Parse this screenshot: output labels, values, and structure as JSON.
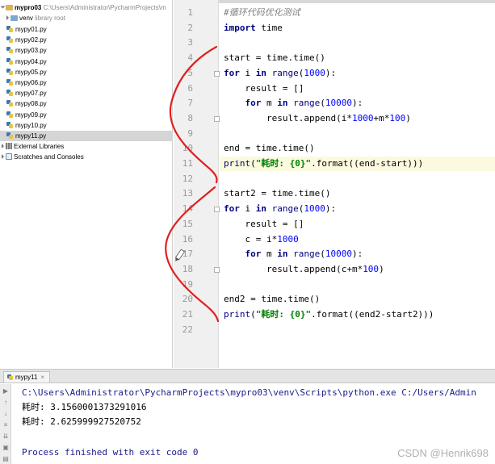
{
  "project_tree": {
    "root": {
      "name": "mypro03",
      "path": "C:\\Users\\Administrator\\PycharmProjects\\m"
    },
    "venv": {
      "name": "venv",
      "note": "library root"
    },
    "files": [
      "mypy01.py",
      "mypy02.py",
      "mypy03.py",
      "mypy04.py",
      "mypy05.py",
      "mypy06.py",
      "mypy07.py",
      "mypy08.py",
      "mypy09.py",
      "mypy10.py",
      "mypy11.py"
    ],
    "selected_file": "mypy11.py",
    "external": "External Libraries",
    "scratches": "Scratches and Consoles"
  },
  "editor": {
    "lines": [
      {
        "n": "1",
        "parts": [
          {
            "t": "#循环代码优化测试",
            "c": "cmt"
          }
        ]
      },
      {
        "n": "2",
        "parts": [
          {
            "t": "import",
            "c": "kw"
          },
          {
            "t": " time",
            "c": ""
          }
        ]
      },
      {
        "n": "3",
        "parts": []
      },
      {
        "n": "4",
        "parts": [
          {
            "t": "start = time.time()",
            "c": ""
          }
        ]
      },
      {
        "n": "5",
        "parts": [
          {
            "t": "for",
            "c": "kw"
          },
          {
            "t": " i ",
            "c": ""
          },
          {
            "t": "in",
            "c": "kw"
          },
          {
            "t": " ",
            "c": ""
          },
          {
            "t": "range",
            "c": "bi"
          },
          {
            "t": "(",
            "c": ""
          },
          {
            "t": "1000",
            "c": "num"
          },
          {
            "t": "):",
            "c": ""
          }
        ]
      },
      {
        "n": "6",
        "parts": [
          {
            "t": "    result = []",
            "c": ""
          }
        ]
      },
      {
        "n": "7",
        "parts": [
          {
            "t": "    ",
            "c": ""
          },
          {
            "t": "for",
            "c": "kw"
          },
          {
            "t": " m ",
            "c": ""
          },
          {
            "t": "in",
            "c": "kw"
          },
          {
            "t": " ",
            "c": ""
          },
          {
            "t": "range",
            "c": "bi"
          },
          {
            "t": "(",
            "c": ""
          },
          {
            "t": "10000",
            "c": "num"
          },
          {
            "t": "):",
            "c": ""
          }
        ]
      },
      {
        "n": "8",
        "parts": [
          {
            "t": "        result.append(i*",
            "c": ""
          },
          {
            "t": "1000",
            "c": "num"
          },
          {
            "t": "+m*",
            "c": ""
          },
          {
            "t": "100",
            "c": "num"
          },
          {
            "t": ")",
            "c": ""
          }
        ]
      },
      {
        "n": "9",
        "parts": []
      },
      {
        "n": "10",
        "parts": [
          {
            "t": "end = time.time()",
            "c": ""
          }
        ]
      },
      {
        "n": "11",
        "parts": [
          {
            "t": "print",
            "c": "bi"
          },
          {
            "t": "(",
            "c": ""
          },
          {
            "t": "\"耗时: {0}\"",
            "c": "str"
          },
          {
            "t": ".format((end-start))",
            "c": ""
          },
          {
            "t": ")",
            "c": ""
          }
        ]
      },
      {
        "n": "12",
        "parts": []
      },
      {
        "n": "13",
        "parts": [
          {
            "t": "start2 = time.time()",
            "c": ""
          }
        ]
      },
      {
        "n": "14",
        "parts": [
          {
            "t": "for",
            "c": "kw"
          },
          {
            "t": " i ",
            "c": ""
          },
          {
            "t": "in",
            "c": "kw"
          },
          {
            "t": " ",
            "c": ""
          },
          {
            "t": "range",
            "c": "bi"
          },
          {
            "t": "(",
            "c": ""
          },
          {
            "t": "1000",
            "c": "num"
          },
          {
            "t": "):",
            "c": ""
          }
        ]
      },
      {
        "n": "15",
        "parts": [
          {
            "t": "    result = []",
            "c": ""
          }
        ]
      },
      {
        "n": "16",
        "parts": [
          {
            "t": "    c = i*",
            "c": ""
          },
          {
            "t": "1000",
            "c": "num"
          }
        ]
      },
      {
        "n": "17",
        "parts": [
          {
            "t": "    ",
            "c": ""
          },
          {
            "t": "for",
            "c": "kw"
          },
          {
            "t": " m ",
            "c": ""
          },
          {
            "t": "in",
            "c": "kw"
          },
          {
            "t": " ",
            "c": ""
          },
          {
            "t": "range",
            "c": "bi"
          },
          {
            "t": "(",
            "c": ""
          },
          {
            "t": "10000",
            "c": "num"
          },
          {
            "t": "):",
            "c": ""
          }
        ]
      },
      {
        "n": "18",
        "parts": [
          {
            "t": "        result.append(c+m*",
            "c": ""
          },
          {
            "t": "100",
            "c": "num"
          },
          {
            "t": ")",
            "c": ""
          }
        ]
      },
      {
        "n": "19",
        "parts": []
      },
      {
        "n": "20",
        "parts": [
          {
            "t": "end2 = time.time()",
            "c": ""
          }
        ]
      },
      {
        "n": "21",
        "parts": [
          {
            "t": "print",
            "c": "bi"
          },
          {
            "t": "(",
            "c": ""
          },
          {
            "t": "\"耗时: {0}\"",
            "c": "str"
          },
          {
            "t": ".format((end2-start2)))",
            "c": ""
          }
        ]
      },
      {
        "n": "22",
        "parts": []
      }
    ],
    "current_line": "11"
  },
  "run_panel": {
    "tab_label": "mypy11",
    "command": "C:\\Users\\Administrator\\PycharmProjects\\mypro03\\venv\\Scripts\\python.exe C:/Users/Admin",
    "output": [
      "耗时: 3.1560001373291016",
      "耗时: 2.625999927520752"
    ],
    "exit_message": "Process finished with exit code 0"
  },
  "watermark": "CSDN @Henrik698",
  "colors": {
    "annotation_red": "#e02020",
    "current_line_bg": "#fbfade"
  }
}
